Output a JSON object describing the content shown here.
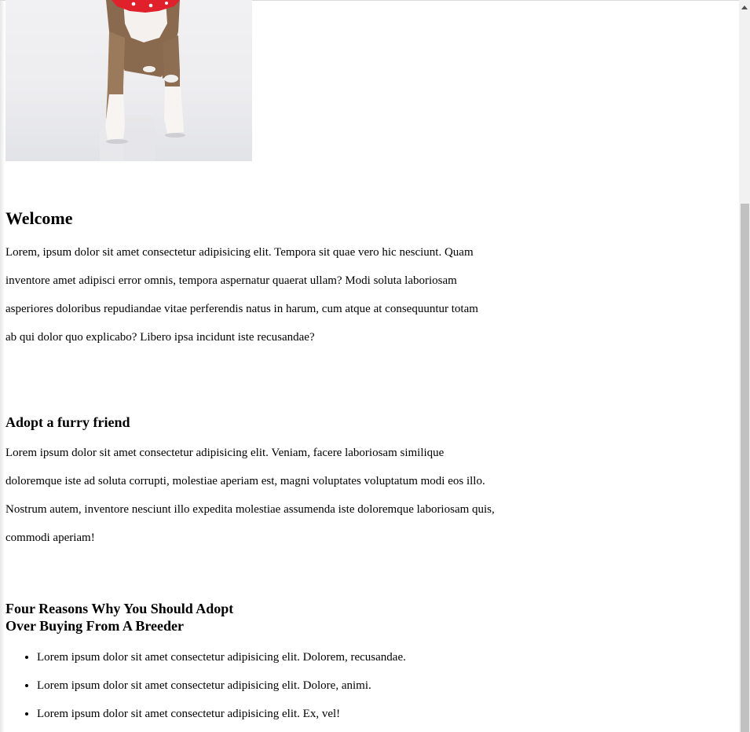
{
  "hero": {
    "image_alt": "Dog standing on a white floor wearing a red bandana"
  },
  "welcome": {
    "title": "Welcome",
    "body": "Lorem, ipsum dolor sit amet consectetur adipisicing elit. Tempora sit quae vero hic nesciunt. Quam inventore amet adipisci error omnis, tempora aspernatur quaerat ullam? Modi soluta laboriosam asperiores doloribus repudiandae vitae perferendis natus in harum, cum atque at consequuntur totam ab qui dolor quo explicabo? Libero ipsa incidunt iste recusandae?"
  },
  "adopt": {
    "title": "Adopt a furry friend",
    "body": "Lorem ipsum dolor sit amet consectetur adipisicing elit. Veniam, facere laboriosam similique doloremque iste ad soluta corrupti, molestiae aperiam est, magni voluptates voluptatum modi eos illo. Nostrum autem, inventore nesciunt illo expedita molestiae assumenda iste doloremque laboriosam quis, commodi aperiam!"
  },
  "reasons": {
    "title_line1": "Four Reasons Why You Should Adopt",
    "title_line2": "Over Buying From A Breeder",
    "items": [
      "Lorem ipsum dolor sit amet consectetur adipisicing elit. Dolorem, recusandae.",
      "Lorem ipsum dolor sit amet consectetur adipisicing elit. Dolore, animi.",
      "Lorem ipsum dolor sit amet consectetur adipisicing elit. Ex, vel!"
    ]
  },
  "scrollbar": {
    "up_icon": "triangle-up-icon",
    "scroll_position": 0.28
  },
  "colors": {
    "scroll_track": "#f1f1f1",
    "scroll_thumb": "#c1c1c1",
    "bandana": "#e0202a"
  }
}
